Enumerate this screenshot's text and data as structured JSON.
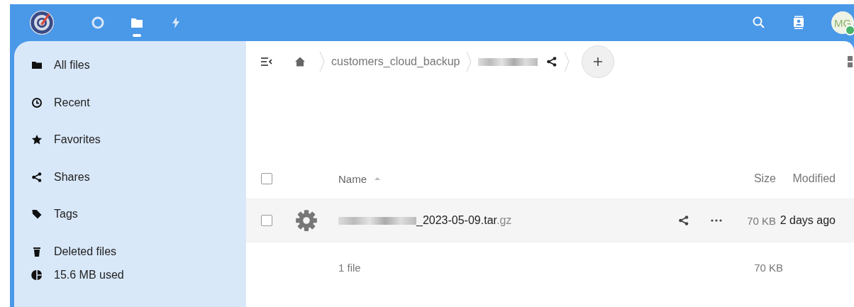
{
  "header": {
    "apps": [
      {
        "kind": "dashboard",
        "selected": false
      },
      {
        "kind": "files",
        "selected": true
      },
      {
        "kind": "activity",
        "selected": false
      }
    ],
    "avatar": {
      "initials": "MG",
      "online": true
    }
  },
  "sidebar": {
    "items": [
      {
        "kind": "folder",
        "label": "All files",
        "selected": false
      },
      {
        "kind": "clock",
        "label": "Recent",
        "selected": false
      },
      {
        "kind": "star",
        "label": "Favorites",
        "selected": false
      },
      {
        "kind": "share",
        "label": "Shares",
        "selected": false
      },
      {
        "kind": "tag",
        "label": "Tags",
        "selected": false
      },
      {
        "kind": "trash",
        "label": "Deleted files",
        "selected": false
      }
    ],
    "quota": {
      "label": "15.6 MB used"
    }
  },
  "breadcrumbs": [
    {
      "kind": "home"
    },
    {
      "kind": "text",
      "label": "customers_cloud_backup"
    },
    {
      "kind": "redacted",
      "shared": true
    }
  ],
  "table": {
    "select_all": {
      "checked": false
    },
    "columns": [
      {
        "label": "Name",
        "sorted": true
      },
      {
        "label": "Size"
      },
      {
        "label": "Modified"
      }
    ],
    "rows": [
      {
        "checked": false,
        "redacted_prefix": true,
        "name": "_2023-05-09.tar",
        "extension": ".gz",
        "size": "70 KB",
        "modified": "2 days ago"
      }
    ],
    "summary": {
      "count": "1 file",
      "size": "70 KB"
    }
  }
}
